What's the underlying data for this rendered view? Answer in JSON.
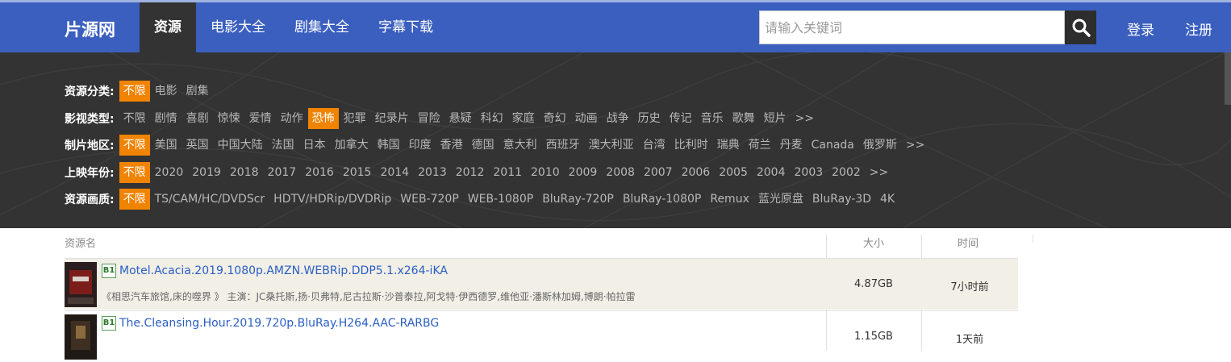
{
  "header": {
    "logo": "片源网",
    "nav": [
      "资源",
      "电影大全",
      "剧集大全",
      "字幕下载"
    ],
    "search_placeholder": "请输入关键词",
    "login": "登录",
    "register": "注册"
  },
  "filters": [
    {
      "label": "资源分类:",
      "options": [
        "不限",
        "电影",
        "剧集"
      ],
      "selected": 0
    },
    {
      "label": "影视类型:",
      "options": [
        "不限",
        "剧情",
        "喜剧",
        "惊悚",
        "爱情",
        "动作",
        "恐怖",
        "犯罪",
        "纪录片",
        "冒险",
        "悬疑",
        "科幻",
        "家庭",
        "奇幻",
        "动画",
        "战争",
        "历史",
        "传记",
        "音乐",
        "歌舞",
        "短片",
        ">>"
      ],
      "selected": 6
    },
    {
      "label": "制片地区:",
      "options": [
        "不限",
        "美国",
        "英国",
        "中国大陆",
        "法国",
        "日本",
        "加拿大",
        "韩国",
        "印度",
        "香港",
        "德国",
        "意大利",
        "西班牙",
        "澳大利亚",
        "台湾",
        "比利时",
        "瑞典",
        "荷兰",
        "丹麦",
        "Canada",
        "俄罗斯",
        ">>"
      ],
      "selected": 0
    },
    {
      "label": "上映年份:",
      "options": [
        "不限",
        "2020",
        "2019",
        "2018",
        "2017",
        "2016",
        "2015",
        "2014",
        "2013",
        "2012",
        "2011",
        "2010",
        "2009",
        "2008",
        "2007",
        "2006",
        "2005",
        "2004",
        "2003",
        "2002",
        ">>"
      ],
      "selected": 0
    },
    {
      "label": "资源画质:",
      "options": [
        "不限",
        "TS/CAM/HC/DVDScr",
        "HDTV/HDRip/DVDRip",
        "WEB-720P",
        "WEB-1080P",
        "BluRay-720P",
        "BluRay-1080P",
        "Remux",
        "蓝光原盘",
        "BluRay-3D",
        "4K"
      ],
      "selected": 0
    }
  ],
  "table": {
    "headers": {
      "name": "资源名",
      "size": "大小",
      "time": "时间"
    },
    "rows": [
      {
        "badge": "B1",
        "title": "Motel.Acacia.2019.1080p.AMZN.WEBRip.DDP5.1.x264-iKA",
        "desc": "《相思汽车旅馆,床的噬界 》 主演：JC桑托斯,扬·贝弗特,尼古拉斯·沙普泰拉,阿戈特·伊西德罗,维他亚·潘斯林加姆,博朗·帕拉雷",
        "size": "4.87GB",
        "time": "7小时前"
      },
      {
        "badge": "B1",
        "title": "The.Cleansing.Hour.2019.720p.BluRay.H264.AAC-RARBG",
        "desc": "",
        "size": "1.15GB",
        "time": "1天前"
      }
    ]
  },
  "colors": {
    "header_bg": "#3b5fbf",
    "filter_bg": "#333333",
    "selected": "#f08300",
    "link": "#2a5ec5"
  }
}
